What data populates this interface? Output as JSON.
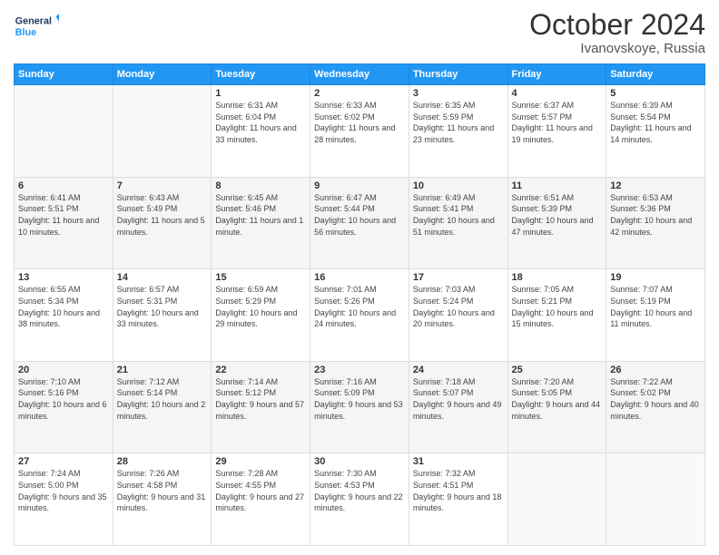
{
  "header": {
    "logo_line1": "General",
    "logo_line2": "Blue",
    "month": "October 2024",
    "location": "Ivanovskoye, Russia"
  },
  "days_of_week": [
    "Sunday",
    "Monday",
    "Tuesday",
    "Wednesday",
    "Thursday",
    "Friday",
    "Saturday"
  ],
  "weeks": [
    [
      {
        "day": "",
        "empty": true
      },
      {
        "day": "",
        "empty": true
      },
      {
        "day": "1",
        "sunrise": "6:31 AM",
        "sunset": "6:04 PM",
        "daylight": "11 hours and 33 minutes."
      },
      {
        "day": "2",
        "sunrise": "6:33 AM",
        "sunset": "6:02 PM",
        "daylight": "11 hours and 28 minutes."
      },
      {
        "day": "3",
        "sunrise": "6:35 AM",
        "sunset": "5:59 PM",
        "daylight": "11 hours and 23 minutes."
      },
      {
        "day": "4",
        "sunrise": "6:37 AM",
        "sunset": "5:57 PM",
        "daylight": "11 hours and 19 minutes."
      },
      {
        "day": "5",
        "sunrise": "6:39 AM",
        "sunset": "5:54 PM",
        "daylight": "11 hours and 14 minutes."
      }
    ],
    [
      {
        "day": "6",
        "sunrise": "6:41 AM",
        "sunset": "5:51 PM",
        "daylight": "11 hours and 10 minutes."
      },
      {
        "day": "7",
        "sunrise": "6:43 AM",
        "sunset": "5:49 PM",
        "daylight": "11 hours and 5 minutes."
      },
      {
        "day": "8",
        "sunrise": "6:45 AM",
        "sunset": "5:46 PM",
        "daylight": "11 hours and 1 minute."
      },
      {
        "day": "9",
        "sunrise": "6:47 AM",
        "sunset": "5:44 PM",
        "daylight": "10 hours and 56 minutes."
      },
      {
        "day": "10",
        "sunrise": "6:49 AM",
        "sunset": "5:41 PM",
        "daylight": "10 hours and 51 minutes."
      },
      {
        "day": "11",
        "sunrise": "6:51 AM",
        "sunset": "5:39 PM",
        "daylight": "10 hours and 47 minutes."
      },
      {
        "day": "12",
        "sunrise": "6:53 AM",
        "sunset": "5:36 PM",
        "daylight": "10 hours and 42 minutes."
      }
    ],
    [
      {
        "day": "13",
        "sunrise": "6:55 AM",
        "sunset": "5:34 PM",
        "daylight": "10 hours and 38 minutes."
      },
      {
        "day": "14",
        "sunrise": "6:57 AM",
        "sunset": "5:31 PM",
        "daylight": "10 hours and 33 minutes."
      },
      {
        "day": "15",
        "sunrise": "6:59 AM",
        "sunset": "5:29 PM",
        "daylight": "10 hours and 29 minutes."
      },
      {
        "day": "16",
        "sunrise": "7:01 AM",
        "sunset": "5:26 PM",
        "daylight": "10 hours and 24 minutes."
      },
      {
        "day": "17",
        "sunrise": "7:03 AM",
        "sunset": "5:24 PM",
        "daylight": "10 hours and 20 minutes."
      },
      {
        "day": "18",
        "sunrise": "7:05 AM",
        "sunset": "5:21 PM",
        "daylight": "10 hours and 15 minutes."
      },
      {
        "day": "19",
        "sunrise": "7:07 AM",
        "sunset": "5:19 PM",
        "daylight": "10 hours and 11 minutes."
      }
    ],
    [
      {
        "day": "20",
        "sunrise": "7:10 AM",
        "sunset": "5:16 PM",
        "daylight": "10 hours and 6 minutes."
      },
      {
        "day": "21",
        "sunrise": "7:12 AM",
        "sunset": "5:14 PM",
        "daylight": "10 hours and 2 minutes."
      },
      {
        "day": "22",
        "sunrise": "7:14 AM",
        "sunset": "5:12 PM",
        "daylight": "9 hours and 57 minutes."
      },
      {
        "day": "23",
        "sunrise": "7:16 AM",
        "sunset": "5:09 PM",
        "daylight": "9 hours and 53 minutes."
      },
      {
        "day": "24",
        "sunrise": "7:18 AM",
        "sunset": "5:07 PM",
        "daylight": "9 hours and 49 minutes."
      },
      {
        "day": "25",
        "sunrise": "7:20 AM",
        "sunset": "5:05 PM",
        "daylight": "9 hours and 44 minutes."
      },
      {
        "day": "26",
        "sunrise": "7:22 AM",
        "sunset": "5:02 PM",
        "daylight": "9 hours and 40 minutes."
      }
    ],
    [
      {
        "day": "27",
        "sunrise": "7:24 AM",
        "sunset": "5:00 PM",
        "daylight": "9 hours and 35 minutes."
      },
      {
        "day": "28",
        "sunrise": "7:26 AM",
        "sunset": "4:58 PM",
        "daylight": "9 hours and 31 minutes."
      },
      {
        "day": "29",
        "sunrise": "7:28 AM",
        "sunset": "4:55 PM",
        "daylight": "9 hours and 27 minutes."
      },
      {
        "day": "30",
        "sunrise": "7:30 AM",
        "sunset": "4:53 PM",
        "daylight": "9 hours and 22 minutes."
      },
      {
        "day": "31",
        "sunrise": "7:32 AM",
        "sunset": "4:51 PM",
        "daylight": "9 hours and 18 minutes."
      },
      {
        "day": "",
        "empty": true
      },
      {
        "day": "",
        "empty": true
      }
    ]
  ]
}
